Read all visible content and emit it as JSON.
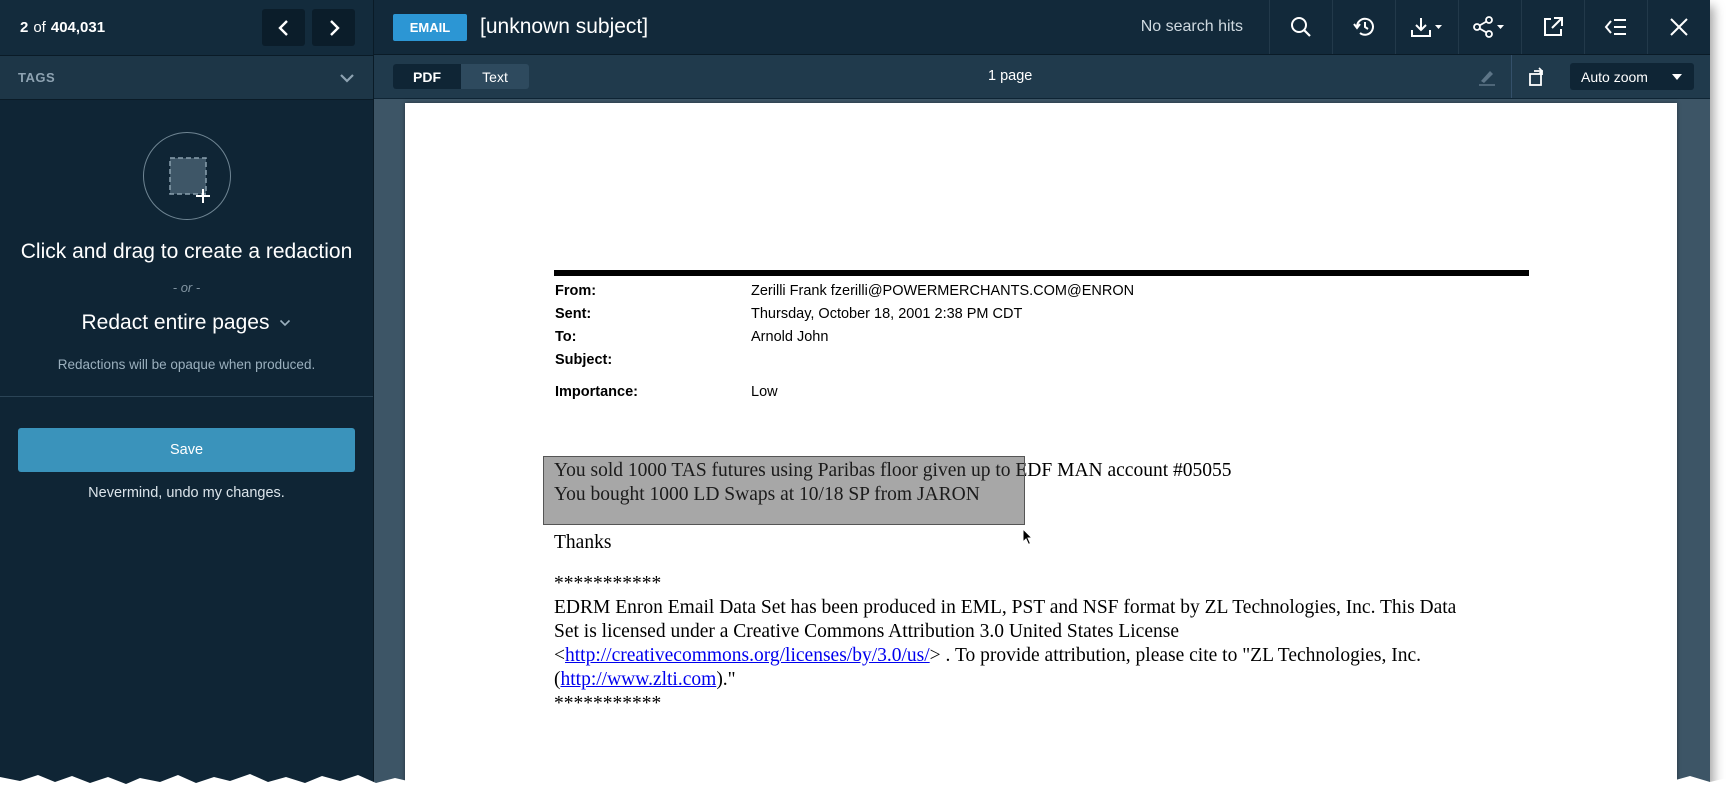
{
  "navigator": {
    "current": "2",
    "of_label": "of",
    "total": "404,031"
  },
  "tags": {
    "label": "TAGS"
  },
  "redaction": {
    "title": "Click and drag to create a redaction",
    "or_label": "- or -",
    "entire_pages_label": "Redact entire pages",
    "opaque_note": "Redactions will be opaque when produced.",
    "save_label": "Save",
    "undo_label": "Nevermind, undo my changes."
  },
  "header": {
    "badge": "EMAIL",
    "subject": "[unknown subject]",
    "search_hits": "No search hits"
  },
  "viewer": {
    "tabs": [
      {
        "label": "PDF",
        "active": true
      },
      {
        "label": "Text",
        "active": false
      }
    ],
    "page_count": "1 page",
    "zoom": "Auto zoom"
  },
  "document": {
    "fields": [
      {
        "label": "From:",
        "value": "Zerilli  Frank fzerilli@POWERMERCHANTS.COM@ENRON"
      },
      {
        "label": "Sent:",
        "value": "Thursday, October 18, 2001 2:38 PM CDT"
      },
      {
        "label": "To:",
        "value": "Arnold  John"
      },
      {
        "label": "Subject:",
        "value": ""
      },
      {
        "label": "Importance:",
        "value": "Low"
      }
    ],
    "body_lines": [
      "You sold 1000 TAS futures using Paribas floor given up to EDF MAN account #05055",
      "You bought 1000 LD Swaps at 10/18 SP from JARON"
    ],
    "thanks": "Thanks",
    "stars": "***********",
    "footer_line1": "EDRM Enron Email Data Set has been produced in EML, PST and NSF format by ZL Technologies, Inc. This Data",
    "footer_line2": "Set is licensed under a Creative Commons Attribution 3.0 United States License",
    "footer_line3_pre": "<",
    "footer_link1": "http://creativecommons.org/licenses/by/3.0/us/",
    "footer_line3_post": "> . To provide attribution, please cite to \"ZL Technologies, Inc.",
    "footer_line4_pre": "(",
    "footer_link2": "http://www.zlti.com",
    "footer_line4_post": ").\""
  },
  "colors": {
    "sidebar_bg": "#0f2535",
    "accent_save": "#3a93bb",
    "email_badge": "#2c96d4"
  },
  "icons": [
    "chevron-left-icon",
    "chevron-right-icon",
    "chevron-down-icon",
    "redaction-icon",
    "search-icon",
    "history-icon",
    "download-icon",
    "share-icon",
    "popout-icon",
    "collapse-icon",
    "close-icon",
    "highlighter-icon",
    "rotate-icon"
  ]
}
